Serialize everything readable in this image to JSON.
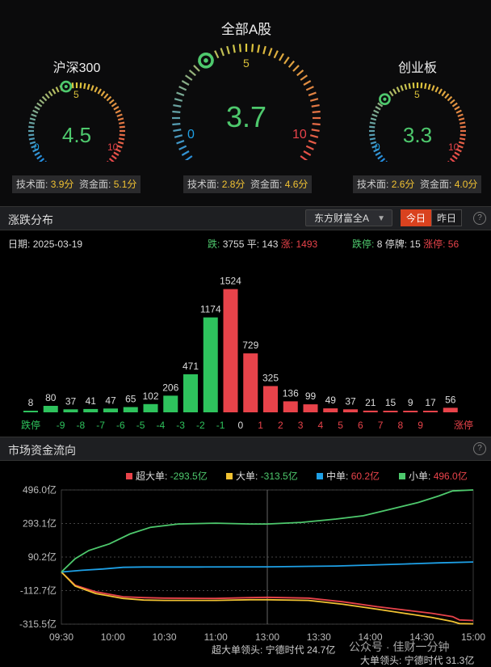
{
  "gauges": [
    {
      "title": "沪深300",
      "value": "4.5",
      "tick_min": "0",
      "tick_mid": "5",
      "tick_max": "10",
      "tech_label": "技术面:",
      "tech_value": "3.9分",
      "fund_label": "资金面:",
      "fund_value": "5.1分",
      "level": 0.45
    },
    {
      "title": "全部A股",
      "value": "3.7",
      "tick_min": "0",
      "tick_mid": "5",
      "tick_max": "10",
      "tech_label": "技术面:",
      "tech_value": "2.8分",
      "fund_label": "资金面:",
      "fund_value": "4.6分",
      "level": 0.37
    },
    {
      "title": "创业板",
      "value": "3.3",
      "tick_min": "0",
      "tick_mid": "5",
      "tick_max": "10",
      "tech_label": "技术面:",
      "tech_value": "2.6分",
      "fund_label": "资金面:",
      "fund_value": "4.0分",
      "level": 0.33
    }
  ],
  "dist_section": {
    "title": "涨跌分布",
    "dropdown": "东方财富全A",
    "tab_today": "今日",
    "tab_yesterday": "昨日",
    "help": "?",
    "date_label": "日期:",
    "date_value": "2025-03-19",
    "fall_label": "跌:",
    "fall_value": "3755",
    "flat_label": "平:",
    "flat_value": "143",
    "rise_label": "涨:",
    "rise_value": "1493",
    "limit_down_label": "跌停:",
    "limit_down_value": "8",
    "suspend_label": "停牌:",
    "suspend_value": "15",
    "limit_up_label": "涨停:",
    "limit_up_value": "56"
  },
  "flow_section": {
    "title": "市场资金流向",
    "help": "?",
    "leaders_1": "超大单领头: 宁德时代 24.7亿",
    "leaders_2": "大单领头: 宁德时代 31.3亿"
  },
  "watermark": "公众号 · 佳财一分钟",
  "colors": {
    "up": "#e8434a",
    "down": "#2ec35d",
    "super": "#e8434a",
    "large": "#f1c232",
    "medium": "#1ea0e6",
    "small": "#4ec96d",
    "accent": "#d9421f"
  },
  "chart_data": [
    {
      "type": "bar",
      "title": "涨跌分布",
      "categories": [
        "跌停",
        "-9",
        "-8",
        "-7",
        "-6",
        "-5",
        "-4",
        "-3",
        "-2",
        "-1",
        "0",
        "1",
        "2",
        "3",
        "4",
        "5",
        "6",
        "7",
        "8",
        "9",
        "涨停"
      ],
      "values": [
        8,
        80,
        37,
        41,
        47,
        65,
        102,
        206,
        471,
        1174,
        1524,
        729,
        325,
        136,
        99,
        49,
        37,
        21,
        15,
        9,
        17,
        56
      ],
      "value_labels": [
        "8",
        "80",
        "37",
        "41",
        "47",
        "65",
        "102",
        "206",
        "471",
        "1174",
        "1524",
        "729",
        "325",
        "136",
        "99",
        "49",
        "37",
        "21",
        "15",
        "9",
        "17",
        "56"
      ],
      "ylim": [
        0,
        1600
      ]
    },
    {
      "type": "line",
      "title": "市场资金流向",
      "x_ticks": [
        "09:30",
        "10:00",
        "10:30",
        "11:00",
        "13:00",
        "13:30",
        "14:00",
        "14:30",
        "15:00"
      ],
      "y_ticks": [
        "496.0亿",
        "293.1亿",
        "90.2亿",
        "-112.7亿",
        "-315.5亿"
      ],
      "ylim": [
        -315.5,
        496.0
      ],
      "series": [
        {
          "name": "超大单",
          "value_label": "-293.5亿",
          "points": [
            [
              0,
              0
            ],
            [
              4,
              -80
            ],
            [
              10,
              -120
            ],
            [
              18,
              -150
            ],
            [
              24,
              -155
            ],
            [
              30,
              -158
            ],
            [
              45,
              -160
            ],
            [
              55,
              -155
            ],
            [
              60,
              -153
            ],
            [
              72,
              -158
            ],
            [
              82,
              -180
            ],
            [
              92,
              -210
            ],
            [
              100,
              -230
            ],
            [
              108,
              -250
            ],
            [
              114,
              -270
            ],
            [
              116,
              -290
            ],
            [
              120,
              -293.5
            ]
          ]
        },
        {
          "name": "大单",
          "value_label": "-313.5亿",
          "points": [
            [
              0,
              0
            ],
            [
              4,
              -85
            ],
            [
              10,
              -130
            ],
            [
              18,
              -160
            ],
            [
              24,
              -170
            ],
            [
              30,
              -172
            ],
            [
              45,
              -172
            ],
            [
              55,
              -168
            ],
            [
              60,
              -168
            ],
            [
              72,
              -172
            ],
            [
              82,
              -195
            ],
            [
              92,
              -225
            ],
            [
              100,
              -250
            ],
            [
              108,
              -275
            ],
            [
              114,
              -300
            ],
            [
              116,
              -312
            ],
            [
              120,
              -313.5
            ]
          ]
        },
        {
          "name": "中单",
          "value_label": "60.2亿",
          "points": [
            [
              0,
              0
            ],
            [
              6,
              10
            ],
            [
              12,
              18
            ],
            [
              18,
              28
            ],
            [
              24,
              30
            ],
            [
              40,
              30
            ],
            [
              60,
              31
            ],
            [
              80,
              36
            ],
            [
              100,
              48
            ],
            [
              110,
              55
            ],
            [
              120,
              60.2
            ]
          ]
        },
        {
          "name": "小单",
          "value_label": "496.0亿",
          "points": [
            [
              0,
              0
            ],
            [
              4,
              80
            ],
            [
              8,
              130
            ],
            [
              14,
              170
            ],
            [
              20,
              230
            ],
            [
              26,
              270
            ],
            [
              34,
              290
            ],
            [
              45,
              295
            ],
            [
              55,
              290
            ],
            [
              60,
              290
            ],
            [
              70,
              300
            ],
            [
              80,
              320
            ],
            [
              88,
              340
            ],
            [
              96,
              380
            ],
            [
              104,
              420
            ],
            [
              110,
              460
            ],
            [
              114,
              490
            ],
            [
              120,
              496.0
            ]
          ]
        }
      ]
    }
  ]
}
